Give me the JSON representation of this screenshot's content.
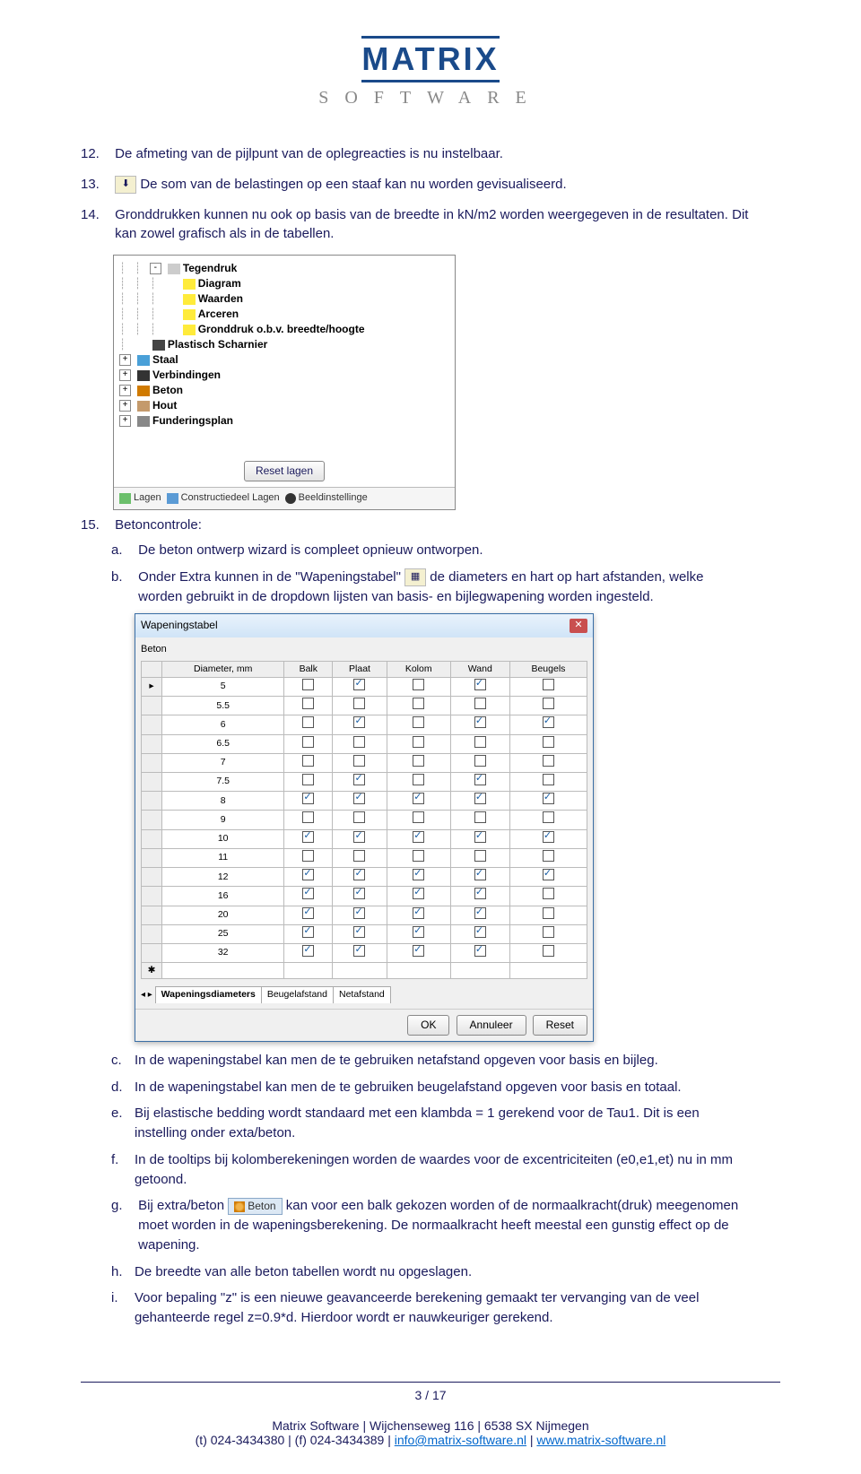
{
  "logo": {
    "top": "MATRIX",
    "bottom": "SOFTWARE"
  },
  "items": {
    "i12": {
      "num": "12.",
      "text": "De afmeting van de pijlpunt van de oplegreacties is nu instelbaar."
    },
    "i13": {
      "num": "13.",
      "text": "De som van de belastingen op een staaf kan nu worden gevisualiseerd."
    },
    "i14": {
      "num": "14.",
      "text": "Gronddrukken kunnen nu ook op basis van de breedte in kN/m2 worden weergegeven in de resultaten. Dit kan zowel grafisch als in de tabellen."
    },
    "i15": {
      "num": "15.",
      "text": "Betoncontrole:"
    }
  },
  "tree": {
    "rows": [
      {
        "indent": 2,
        "exp": "-",
        "icon": "",
        "label": "Tegendruk",
        "bold": true
      },
      {
        "indent": 3,
        "exp": "",
        "icon": "bulb",
        "label": "Diagram",
        "bold": true
      },
      {
        "indent": 3,
        "exp": "",
        "icon": "bulb",
        "label": "Waarden",
        "bold": true
      },
      {
        "indent": 3,
        "exp": "",
        "icon": "bulb",
        "label": "Arceren",
        "bold": true
      },
      {
        "indent": 3,
        "exp": "",
        "icon": "bulb",
        "label": "Gronddruk o.b.v. breedte/hoogte",
        "bold": true
      },
      {
        "indent": 1,
        "exp": "",
        "icon": "hinge",
        "label": "Plastisch Scharnier",
        "bold": true
      },
      {
        "indent": 0,
        "exp": "+",
        "icon": "steel",
        "label": "Staal",
        "bold": true
      },
      {
        "indent": 0,
        "exp": "+",
        "icon": "conn",
        "label": "Verbindingen",
        "bold": true
      },
      {
        "indent": 0,
        "exp": "+",
        "icon": "beton",
        "label": "Beton",
        "bold": true
      },
      {
        "indent": 0,
        "exp": "+",
        "icon": "wood",
        "label": "Hout",
        "bold": true
      },
      {
        "indent": 0,
        "exp": "+",
        "icon": "fund",
        "label": "Funderingsplan",
        "bold": true
      }
    ],
    "reset": "Reset lagen",
    "tabs": {
      "t1": "Lagen",
      "t2": "Constructiedeel Lagen",
      "t3": "Beeldinstellinge"
    }
  },
  "sub": {
    "a": {
      "l": "a.",
      "t": "De beton ontwerp wizard is compleet opnieuw ontworpen."
    },
    "b": {
      "l": "b.",
      "t1": "Onder Extra kunnen in de \"Wapeningstabel\" ",
      "t2": " de diameters en hart op hart afstanden, welke worden gebruikt in de dropdown lijsten van basis- en bijlegwapening worden ingesteld."
    },
    "c": {
      "l": "c.",
      "t": "In de wapeningstabel kan men de te gebruiken netafstand opgeven voor basis en bijleg."
    },
    "d": {
      "l": "d.",
      "t": "In de wapeningstabel kan men de te gebruiken beugelafstand opgeven voor basis en totaal."
    },
    "e": {
      "l": "e.",
      "t": "Bij elastische bedding wordt standaard met een klambda = 1 gerekend voor de Tau1. Dit is een instelling onder exta/beton."
    },
    "f": {
      "l": "f.",
      "t": "In de tooltips bij kolomberekeningen worden de waardes voor de excentriciteiten (e0,e1,et) nu in mm getoond."
    },
    "g": {
      "l": "g.",
      "t1": "Bij extra/beton ",
      "tag": "Beton",
      "t2": " kan voor een balk gekozen worden of de normaalkracht(druk) meegenomen moet worden in de wapeningsberekening. De normaalkracht heeft meestal een gunstig effect op de wapening."
    },
    "h": {
      "l": "h.",
      "t": "De breedte van alle beton tabellen wordt nu opgeslagen."
    },
    "i": {
      "l": "i.",
      "t": "Voor bepaling \"z\" is een nieuwe geavanceerde berekening gemaakt ter vervanging van de veel gehanteerde regel z=0.9*d. Hierdoor wordt er nauwkeuriger gerekend."
    }
  },
  "dlg": {
    "title": "Wapeningstabel",
    "section": "Beton",
    "headers": [
      "Diameter, mm",
      "Balk",
      "Plaat",
      "Kolom",
      "Wand",
      "Beugels"
    ],
    "rows": [
      {
        "d": "5",
        "c": [
          0,
          1,
          0,
          1,
          0
        ]
      },
      {
        "d": "5.5",
        "c": [
          0,
          0,
          0,
          0,
          0
        ]
      },
      {
        "d": "6",
        "c": [
          0,
          1,
          0,
          1,
          1
        ]
      },
      {
        "d": "6.5",
        "c": [
          0,
          0,
          0,
          0,
          0
        ]
      },
      {
        "d": "7",
        "c": [
          0,
          0,
          0,
          0,
          0
        ]
      },
      {
        "d": "7.5",
        "c": [
          0,
          1,
          0,
          1,
          0
        ]
      },
      {
        "d": "8",
        "c": [
          1,
          1,
          1,
          1,
          1
        ]
      },
      {
        "d": "9",
        "c": [
          0,
          0,
          0,
          0,
          0
        ]
      },
      {
        "d": "10",
        "c": [
          1,
          1,
          1,
          1,
          1
        ]
      },
      {
        "d": "11",
        "c": [
          0,
          0,
          0,
          0,
          0
        ]
      },
      {
        "d": "12",
        "c": [
          1,
          1,
          1,
          1,
          1
        ]
      },
      {
        "d": "16",
        "c": [
          1,
          1,
          1,
          1,
          0
        ]
      },
      {
        "d": "20",
        "c": [
          1,
          1,
          1,
          1,
          0
        ]
      },
      {
        "d": "25",
        "c": [
          1,
          1,
          1,
          1,
          0
        ]
      },
      {
        "d": "32",
        "c": [
          1,
          1,
          1,
          1,
          0
        ]
      }
    ],
    "tabs": [
      "Wapeningsdiameters",
      "Beugelafstand",
      "Netafstand"
    ],
    "btns": {
      "ok": "OK",
      "cancel": "Annuleer",
      "reset": "Reset"
    }
  },
  "footer": {
    "page": "3 / 17",
    "line1a": "Matrix Software | Wijchenseweg 116 | 6538 SX Nijmegen",
    "line2a": "(t) 024-3434380 | (f) 024-3434389 | ",
    "email": "info@matrix-software.nl",
    "sep": " | ",
    "web": "www.matrix-software.nl"
  }
}
